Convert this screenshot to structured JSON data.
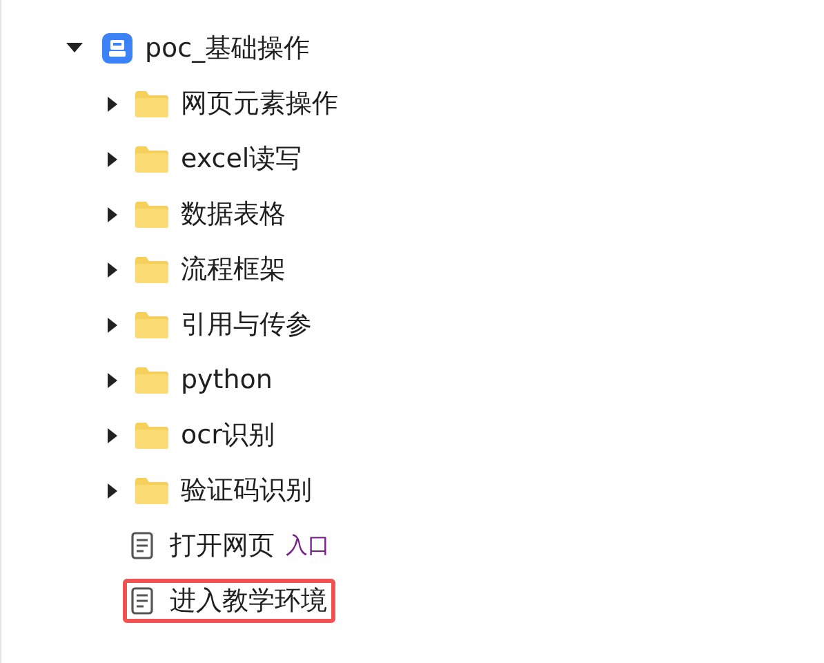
{
  "tree": {
    "label": "poc_基础操作",
    "expanded": true,
    "children": [
      {
        "kind": "folder",
        "label": "网页元素操作",
        "expanded": false
      },
      {
        "kind": "folder",
        "label": "excel读写",
        "expanded": false
      },
      {
        "kind": "folder",
        "label": "数据表格",
        "expanded": false
      },
      {
        "kind": "folder",
        "label": "流程框架",
        "expanded": false
      },
      {
        "kind": "folder",
        "label": "引用与传参",
        "expanded": false
      },
      {
        "kind": "folder",
        "label": "python",
        "expanded": false
      },
      {
        "kind": "folder",
        "label": "ocr识别",
        "expanded": false
      },
      {
        "kind": "folder",
        "label": "验证码识别",
        "expanded": false
      },
      {
        "kind": "file",
        "label": "打开网页",
        "tag": "入口",
        "selected": false
      },
      {
        "kind": "file",
        "label": "进入教学环境",
        "selected": true
      }
    ]
  }
}
